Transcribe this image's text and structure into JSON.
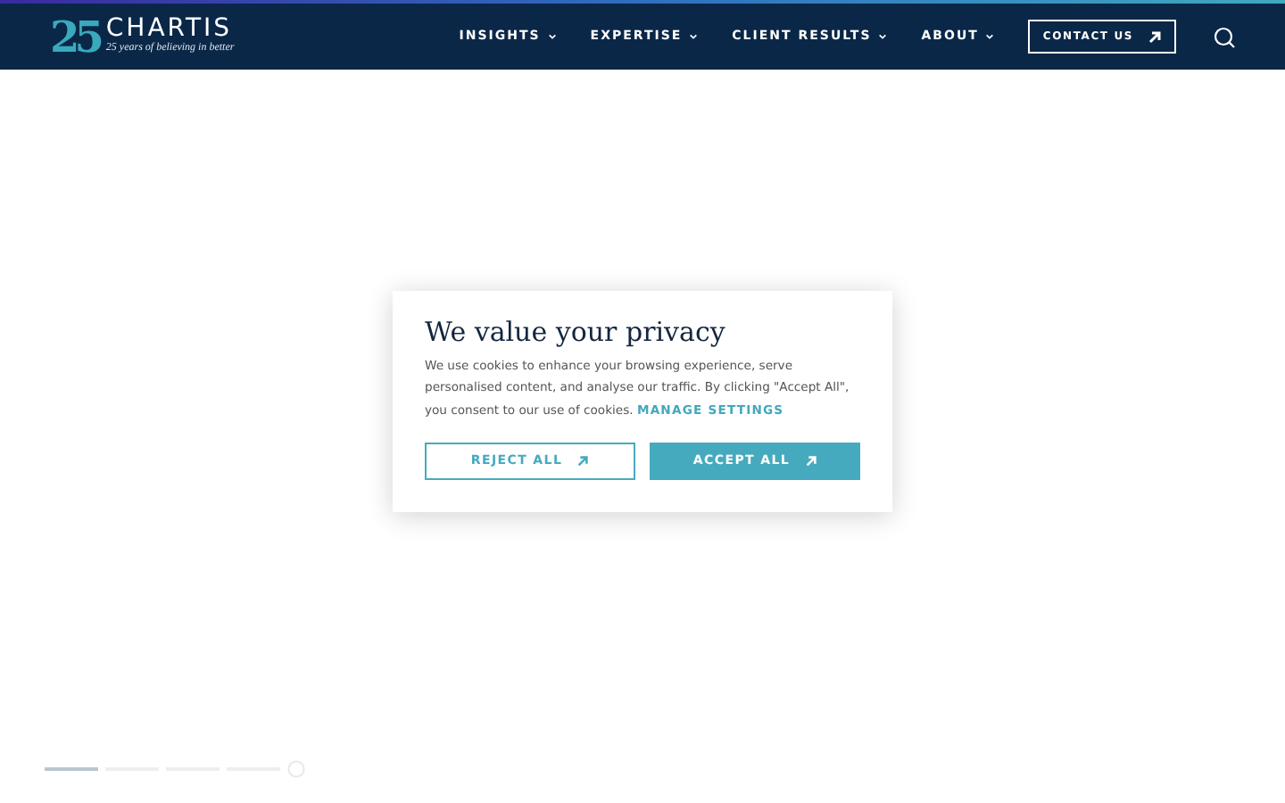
{
  "header": {
    "logo": {
      "mark": "25",
      "brand": "CHARTIS",
      "tagline": "25 years of believing in better"
    },
    "nav": [
      {
        "label": "INSIGHTS",
        "dropdown": true
      },
      {
        "label": "EXPERTISE",
        "dropdown": true
      },
      {
        "label": "CLIENT RESULTS",
        "dropdown": true
      },
      {
        "label": "ABOUT",
        "dropdown": true
      }
    ],
    "contact": {
      "label": "CONTACT US"
    }
  },
  "cookie_dialog": {
    "title": "We value your privacy",
    "text": "We use cookies to enhance your browsing experience, serve personalised content, and analyse our traffic. By clicking \"Accept All\", you consent to our use of cookies.",
    "link": "MANAGE SETTINGS",
    "buttons": [
      {
        "label": "REJECT ALL",
        "kind": "outline"
      },
      {
        "label": "ACCEPT ALL",
        "kind": "solid"
      }
    ]
  },
  "carousel": {
    "slides": [
      {
        "selected": true
      },
      {
        "selected": false
      },
      {
        "selected": false
      },
      {
        "selected": false
      }
    ]
  }
}
